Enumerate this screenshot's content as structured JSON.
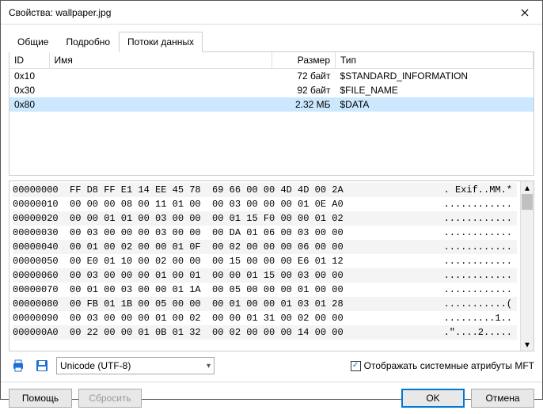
{
  "title": "Свойства: wallpaper.jpg",
  "tabs": {
    "general": "Общие",
    "details": "Подробно",
    "streams": "Потоки данных"
  },
  "table": {
    "headers": {
      "id": "ID",
      "name": "Имя",
      "size": "Размер",
      "type": "Тип"
    },
    "rows": [
      {
        "id": "0x10",
        "name": "",
        "size": "72 байт",
        "type": "$STANDARD_INFORMATION"
      },
      {
        "id": "0x30",
        "name": "",
        "size": "92 байт",
        "type": "$FILE_NAME"
      },
      {
        "id": "0x80",
        "name": "",
        "size": "2.32 МБ",
        "type": "$DATA"
      }
    ]
  },
  "hex": [
    {
      "off": "00000000",
      "b": "FF D8 FF E1 14 EE 45 78  69 66 00 00 4D 4D 00 2A",
      "a": ". Exif..MM.*"
    },
    {
      "off": "00000010",
      "b": "00 00 00 08 00 11 01 00  00 03 00 00 00 01 0E A0",
      "a": "............"
    },
    {
      "off": "00000020",
      "b": "00 00 01 01 00 03 00 00  00 01 15 F0 00 00 01 02",
      "a": "............"
    },
    {
      "off": "00000030",
      "b": "00 03 00 00 00 03 00 00  00 DA 01 06 00 03 00 00",
      "a": "............"
    },
    {
      "off": "00000040",
      "b": "00 01 00 02 00 00 01 0F  00 02 00 00 00 06 00 00",
      "a": "............"
    },
    {
      "off": "00000050",
      "b": "00 E0 01 10 00 02 00 00  00 15 00 00 00 E6 01 12",
      "a": "............"
    },
    {
      "off": "00000060",
      "b": "00 03 00 00 00 01 00 01  00 00 01 15 00 03 00 00",
      "a": "............"
    },
    {
      "off": "00000070",
      "b": "00 01 00 03 00 00 01 1A  00 05 00 00 00 01 00 00",
      "a": "............"
    },
    {
      "off": "00000080",
      "b": "00 FB 01 1B 00 05 00 00  00 01 00 00 01 03 01 28",
      "a": "...........("
    },
    {
      "off": "00000090",
      "b": "00 03 00 00 00 01 00 02  00 00 01 31 00 02 00 00",
      "a": ".........1.."
    },
    {
      "off": "000000A0",
      "b": "00 22 00 00 01 0B 01 32  00 02 00 00 00 14 00 00",
      "a": ".\"....2....."
    }
  ],
  "encoding": "Unicode (UTF-8)",
  "checkbox_label": "Отображать системные атрибуты MFT",
  "buttons": {
    "help": "Помощь",
    "reset": "Сбросить",
    "ok": "OK",
    "cancel": "Отмена"
  }
}
